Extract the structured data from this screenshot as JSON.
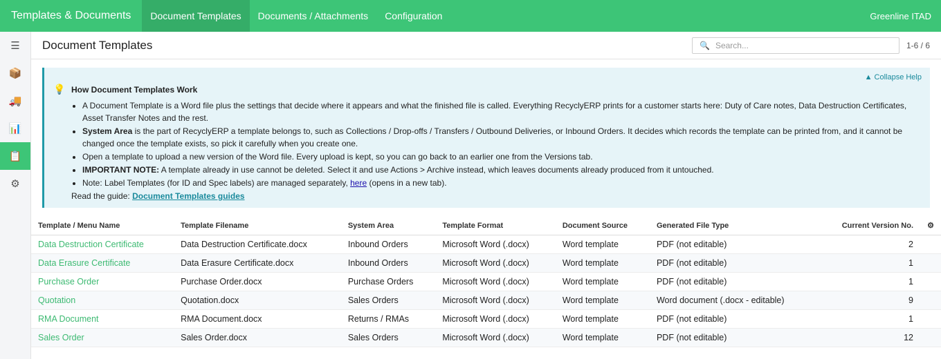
{
  "topbar": {
    "brand": "Templates & Documents",
    "nav": [
      "Document Templates",
      "Documents / Attachments",
      "Configuration"
    ],
    "company": "Greenline ITAD"
  },
  "sidebar": {
    "icons": [
      "menu-icon",
      "box-icon",
      "truck-icon",
      "chart-icon",
      "clipboard-icon",
      "gear-icon"
    ]
  },
  "header": {
    "title": "Document Templates",
    "search_placeholder": "Search...",
    "pager": "1-6 / 6"
  },
  "help": {
    "collapse_label": "▲ Collapse Help",
    "title": "How Document Templates Work",
    "b1": "A Document Template is a Word file plus the settings that decide where it appears and what the finished file is called. Everything RecyclyERP prints for a customer starts here: Duty of Care notes, Data Destruction Certificates, Asset Transfer Notes and the rest.",
    "b2_strong": "System Area",
    "b2_rest": " is the part of RecyclyERP a template belongs to, such as Collections / Drop-offs / Transfers / Outbound Deliveries, or Inbound Orders. It decides which records the template can be printed from, and it cannot be changed once the template exists, so pick it carefully when you create one.",
    "b3": "Open a template to upload a new version of the Word file. Every upload is kept, so you can go back to an earlier one from the Versions tab.",
    "b4_strong": "IMPORTANT NOTE:",
    "b4_rest": " A template already in use cannot be deleted. Select it and use Actions > Archive instead, which leaves documents already produced from it untouched.",
    "b5_pre": "Note: Label Templates (for ID and Spec labels) are managed separately, ",
    "b5_link": "here",
    "b5_post": " (opens in a new tab).",
    "guide_pre": "Read the guide: ",
    "guide_link": "Document Templates guides"
  },
  "table": {
    "columns": [
      "Template / Menu Name",
      "Template Filename",
      "System Area",
      "Template Format",
      "Document Source",
      "Generated File Type",
      "Current Version No."
    ],
    "rows": [
      [
        "Data Destruction Certificate",
        "Data Destruction Certificate.docx",
        "Inbound Orders",
        "Microsoft Word (.docx)",
        "Word template",
        "PDF (not editable)",
        "2"
      ],
      [
        "Data Erasure Certificate",
        "Data Erasure Certificate.docx",
        "Inbound Orders",
        "Microsoft Word (.docx)",
        "Word template",
        "PDF (not editable)",
        "1"
      ],
      [
        "Purchase Order",
        "Purchase Order.docx",
        "Purchase Orders",
        "Microsoft Word (.docx)",
        "Word template",
        "PDF (not editable)",
        "1"
      ],
      [
        "Quotation",
        "Quotation.docx",
        "Sales Orders",
        "Microsoft Word (.docx)",
        "Word template",
        "Word document (.docx - editable)",
        "9"
      ],
      [
        "RMA Document",
        "RMA Document.docx",
        "Returns / RMAs",
        "Microsoft Word (.docx)",
        "Word template",
        "PDF (not editable)",
        "1"
      ],
      [
        "Sales Order",
        "Sales Order.docx",
        "Sales Orders",
        "Microsoft Word (.docx)",
        "Word template",
        "PDF (not editable)",
        "12"
      ]
    ]
  },
  "colors": {
    "accent": "#3dc577",
    "help_border": "#1f9aa8",
    "help_bg": "#e6f4f8"
  }
}
